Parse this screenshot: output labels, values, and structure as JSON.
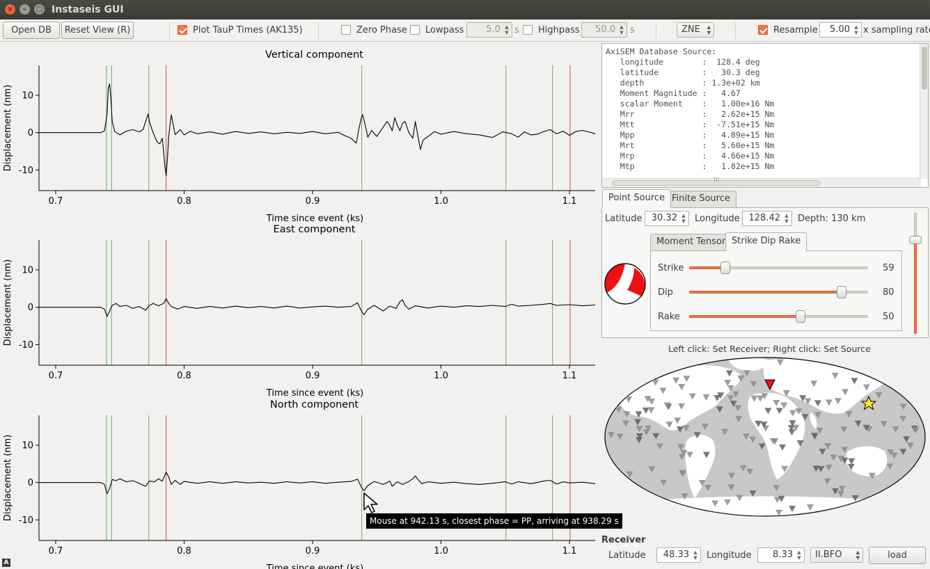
{
  "window": {
    "title": "Instaseis GUI",
    "close_glyph": "×",
    "minimize_glyph": "–",
    "maximize_glyph": "□"
  },
  "toolbar": {
    "open_db_label": "Open DB",
    "reset_view_label": "Reset View (R)",
    "plot_taup_label": "Plot TauP Times (AK135)",
    "plot_taup_checked": true,
    "zero_phase_label": "Zero Phase",
    "zero_phase_checked": false,
    "lowpass_label": "Lowpass",
    "lowpass_checked": false,
    "lowpass_value": "5.0",
    "lowpass_unit": "s",
    "highpass_label": "Highpass",
    "highpass_checked": false,
    "highpass_value": "50.0",
    "highpass_unit": "s",
    "components_value": "ZNE",
    "resample_label": "Resample",
    "resample_checked": true,
    "resample_value": "5.00",
    "resample_unit": "x sampling rate"
  },
  "plots": {
    "ylabel": "Displacement (nm)",
    "xlabel": "Time since event (ks)",
    "panels": [
      {
        "title": "Vertical component"
      },
      {
        "title": "East component"
      },
      {
        "title": "North component"
      }
    ]
  },
  "chart_data": {
    "type": "line",
    "xlim": [
      0.687,
      1.12
    ],
    "ylim": [
      -15.5,
      18
    ],
    "x_ticks": [
      "0.7",
      "0.8",
      "0.9",
      "1.0",
      "1.1"
    ],
    "x_tick_values": [
      0.7,
      0.8,
      0.9,
      1.0,
      1.1
    ],
    "y_ticks": [
      "10",
      "0",
      "-10"
    ],
    "y_tick_values": [
      10,
      0,
      -10
    ],
    "phase_lines": {
      "green": [
        0.7395,
        0.7435,
        0.7725,
        0.9383,
        1.0505,
        1.0868
      ],
      "red": [
        0.786,
        1.1005
      ]
    },
    "colors": {
      "trace": "#000000",
      "green": "#6aa86a",
      "red": "#cc4b4b"
    },
    "series": [
      {
        "points": [
          [
            0.687,
            0
          ],
          [
            0.735,
            0
          ],
          [
            0.738,
            0.5
          ],
          [
            0.74,
            5
          ],
          [
            0.741,
            12
          ],
          [
            0.742,
            13
          ],
          [
            0.743,
            9
          ],
          [
            0.744,
            3
          ],
          [
            0.746,
            0.3
          ],
          [
            0.75,
            -0.6
          ],
          [
            0.755,
            0.4
          ],
          [
            0.76,
            0.8
          ],
          [
            0.765,
            0.2
          ],
          [
            0.768,
            0.8
          ],
          [
            0.771,
            4
          ],
          [
            0.772,
            5
          ],
          [
            0.773,
            3
          ],
          [
            0.775,
            0.8
          ],
          [
            0.777,
            -1
          ],
          [
            0.779,
            -2.5
          ],
          [
            0.781,
            -3
          ],
          [
            0.783,
            -1.5
          ],
          [
            0.784,
            -5
          ],
          [
            0.785,
            -9
          ],
          [
            0.786,
            -11.5
          ],
          [
            0.787,
            -7
          ],
          [
            0.788,
            -1
          ],
          [
            0.789,
            2
          ],
          [
            0.79,
            4.8
          ],
          [
            0.791,
            3
          ],
          [
            0.793,
            -0.5
          ],
          [
            0.797,
            0.8
          ],
          [
            0.8,
            -0.6
          ],
          [
            0.805,
            0.4
          ],
          [
            0.81,
            -0.3
          ],
          [
            0.82,
            0.2
          ],
          [
            0.83,
            -0.4
          ],
          [
            0.84,
            0.3
          ],
          [
            0.85,
            -0.2
          ],
          [
            0.86,
            0.2
          ],
          [
            0.87,
            -0.3
          ],
          [
            0.88,
            0.1
          ],
          [
            0.89,
            -0.2
          ],
          [
            0.9,
            0.3
          ],
          [
            0.91,
            -0.3
          ],
          [
            0.92,
            0.1
          ],
          [
            0.925,
            -0.8
          ],
          [
            0.93,
            -1.5
          ],
          [
            0.934,
            -2.8
          ],
          [
            0.936,
            1
          ],
          [
            0.938,
            4
          ],
          [
            0.939,
            4.8
          ],
          [
            0.941,
            2
          ],
          [
            0.943,
            -1.2
          ],
          [
            0.946,
            0.6
          ],
          [
            0.95,
            -1
          ],
          [
            0.955,
            1.5
          ],
          [
            0.958,
            3
          ],
          [
            0.96,
            2
          ],
          [
            0.962,
            0.5
          ],
          [
            0.964,
            4
          ],
          [
            0.966,
            2
          ],
          [
            0.968,
            0.5
          ],
          [
            0.97,
            2.5
          ],
          [
            0.972,
            3
          ],
          [
            0.975,
            0
          ],
          [
            0.978,
            -1.5
          ],
          [
            0.98,
            3
          ],
          [
            0.982,
            -1
          ],
          [
            0.984,
            -4.5
          ],
          [
            0.986,
            -2
          ],
          [
            0.99,
            -1
          ],
          [
            0.995,
            0.3
          ],
          [
            1.0,
            -0.4
          ],
          [
            1.01,
            0.3
          ],
          [
            1.02,
            -0.3
          ],
          [
            1.03,
            -0.6
          ],
          [
            1.04,
            -1.3
          ],
          [
            1.048,
            0.2
          ],
          [
            1.055,
            -0.3
          ],
          [
            1.06,
            -1.2
          ],
          [
            1.065,
            0.2
          ],
          [
            1.07,
            -0.6
          ],
          [
            1.075,
            -0.4
          ],
          [
            1.08,
            0.3
          ],
          [
            1.085,
            0.8
          ],
          [
            1.09,
            -0.3
          ],
          [
            1.095,
            0.4
          ],
          [
            1.1,
            -0.7
          ],
          [
            1.105,
            0.3
          ],
          [
            1.11,
            0.6
          ],
          [
            1.115,
            0.2
          ],
          [
            1.12,
            -0.3
          ]
        ]
      },
      {
        "points": [
          [
            0.687,
            0
          ],
          [
            0.735,
            0
          ],
          [
            0.738,
            -0.5
          ],
          [
            0.74,
            -2.5
          ],
          [
            0.742,
            -1
          ],
          [
            0.744,
            0.5
          ],
          [
            0.747,
            1
          ],
          [
            0.75,
            0.2
          ],
          [
            0.755,
            0.5
          ],
          [
            0.76,
            -0.3
          ],
          [
            0.765,
            0.2
          ],
          [
            0.77,
            -0.8
          ],
          [
            0.773,
            0.5
          ],
          [
            0.776,
            1
          ],
          [
            0.78,
            0.4
          ],
          [
            0.784,
            1
          ],
          [
            0.786,
            2.3
          ],
          [
            0.788,
            1
          ],
          [
            0.79,
            0.2
          ],
          [
            0.795,
            -0.5
          ],
          [
            0.8,
            0.2
          ],
          [
            0.81,
            -0.3
          ],
          [
            0.82,
            0.2
          ],
          [
            0.83,
            -0.2
          ],
          [
            0.84,
            0.3
          ],
          [
            0.85,
            -0.1
          ],
          [
            0.86,
            0.2
          ],
          [
            0.87,
            -0.2
          ],
          [
            0.88,
            0.3
          ],
          [
            0.89,
            -0.2
          ],
          [
            0.9,
            0.1
          ],
          [
            0.91,
            0.3
          ],
          [
            0.92,
            0
          ],
          [
            0.93,
            0.2
          ],
          [
            0.935,
            1.2
          ],
          [
            0.938,
            -1
          ],
          [
            0.94,
            -2
          ],
          [
            0.943,
            -0.5
          ],
          [
            0.948,
            0.5
          ],
          [
            0.955,
            -1
          ],
          [
            0.96,
            0.3
          ],
          [
            0.965,
            -0.3
          ],
          [
            0.968,
            1.5
          ],
          [
            0.97,
            2
          ],
          [
            0.972,
            0.5
          ],
          [
            0.975,
            -0.5
          ],
          [
            0.98,
            0.4
          ],
          [
            0.99,
            -0.2
          ],
          [
            1.0,
            0.3
          ],
          [
            1.01,
            0
          ],
          [
            1.02,
            0.4
          ],
          [
            1.03,
            0.2
          ],
          [
            1.04,
            0.5
          ],
          [
            1.05,
            0.2
          ],
          [
            1.055,
            0.8
          ],
          [
            1.06,
            0.3
          ],
          [
            1.07,
            0.5
          ],
          [
            1.08,
            0.8
          ],
          [
            1.085,
            1
          ],
          [
            1.09,
            0.5
          ],
          [
            1.1,
            0.7
          ],
          [
            1.11,
            0.4
          ],
          [
            1.12,
            0.6
          ]
        ]
      },
      {
        "points": [
          [
            0.687,
            0
          ],
          [
            0.735,
            0
          ],
          [
            0.738,
            -0.5
          ],
          [
            0.74,
            -3
          ],
          [
            0.742,
            -1.5
          ],
          [
            0.744,
            0.8
          ],
          [
            0.747,
            0.5
          ],
          [
            0.75,
            1
          ],
          [
            0.755,
            0.2
          ],
          [
            0.76,
            0.5
          ],
          [
            0.765,
            -0.2
          ],
          [
            0.77,
            -1
          ],
          [
            0.773,
            0.4
          ],
          [
            0.777,
            0.2
          ],
          [
            0.78,
            1
          ],
          [
            0.783,
            0.4
          ],
          [
            0.786,
            2.8
          ],
          [
            0.788,
            1.5
          ],
          [
            0.79,
            -0.5
          ],
          [
            0.793,
            0.6
          ],
          [
            0.797,
            -0.5
          ],
          [
            0.8,
            0.3
          ],
          [
            0.81,
            -0.2
          ],
          [
            0.82,
            0.2
          ],
          [
            0.83,
            -0.2
          ],
          [
            0.84,
            0.2
          ],
          [
            0.85,
            -0.1
          ],
          [
            0.86,
            0.1
          ],
          [
            0.87,
            -0.2
          ],
          [
            0.88,
            0.2
          ],
          [
            0.89,
            -0.1
          ],
          [
            0.9,
            0.2
          ],
          [
            0.91,
            -0.2
          ],
          [
            0.92,
            0.1
          ],
          [
            0.93,
            0.3
          ],
          [
            0.935,
            0.9
          ],
          [
            0.938,
            -1.2
          ],
          [
            0.94,
            -2.2
          ],
          [
            0.943,
            -0.8
          ],
          [
            0.948,
            0.3
          ],
          [
            0.955,
            -0.5
          ],
          [
            0.96,
            0.4
          ],
          [
            0.962,
            -1
          ],
          [
            0.966,
            0.2
          ],
          [
            0.97,
            -0.5
          ],
          [
            0.975,
            0.3
          ],
          [
            0.978,
            1
          ],
          [
            0.98,
            1.8
          ],
          [
            0.982,
            0.8
          ],
          [
            0.985,
            -0.3
          ],
          [
            0.99,
            0.2
          ],
          [
            1.0,
            -0.2
          ],
          [
            1.01,
            0.1
          ],
          [
            1.02,
            -0.3
          ],
          [
            1.03,
            -0.5
          ],
          [
            1.04,
            -0.2
          ],
          [
            1.05,
            0.2
          ],
          [
            1.055,
            -0.4
          ],
          [
            1.06,
            0.2
          ],
          [
            1.07,
            -0.3
          ],
          [
            1.08,
            0.4
          ],
          [
            1.085,
            0.6
          ],
          [
            1.09,
            -0.4
          ],
          [
            1.095,
            0.2
          ],
          [
            1.1,
            -0.1
          ],
          [
            1.11,
            0.1
          ],
          [
            1.12,
            -0.3
          ]
        ]
      }
    ]
  },
  "source_text": {
    "lines": [
      "AxiSEM Database Source:",
      "   longitude        :  128.4 deg",
      "   latitude         :   30.3 deg",
      "   depth            : 1.3e+02 km",
      "   Moment Magnitude :   4.67",
      "   scalar Moment    :   1.00e+16 Nm",
      "   Mrr              :   2.62e+15 Nm",
      "   Mtt              :  -7.51e+15 Nm",
      "   Mpp              :   4.89e+15 Nm",
      "   Mrt              :   5.60e+15 Nm",
      "   Mrp              :   4.66e+15 Nm",
      "   Mtp              :   1.82e+15 Nm"
    ],
    "scroll_grip": "⁞⁞⁞"
  },
  "source_tabs": {
    "point_source_label": "Point Source",
    "finite_source_label": "Finite Source",
    "latitude_label": "Latitude",
    "latitude_value": "30.32",
    "longitude_label": "Longitude",
    "longitude_value": "128.42",
    "depth_text": "Depth: 130 km",
    "depth_slider_fraction": 0.2,
    "moment_tensor_label": "Moment Tensor",
    "strike_dip_rake_label": "Strike Dip Rake",
    "strike_label": "Strike",
    "strike_value": "59",
    "strike_fraction": 0.18,
    "dip_label": "Dip",
    "dip_value": "80",
    "dip_fraction": 0.87,
    "rake_label": "Rake",
    "rake_value": "50",
    "rake_fraction": 0.63
  },
  "map": {
    "hint": "Left click: Set Receiver; Right click: Set Source",
    "receiver_marker_color": "#ee1111",
    "source_marker_color": "#ffee22"
  },
  "receiver": {
    "heading": "Receiver",
    "latitude_label": "Latitude",
    "latitude_value": "48.33",
    "longitude_label": "Longitude",
    "longitude_value": "8.33",
    "station_value": "II.BFO",
    "load_label": "load"
  },
  "tooltip": {
    "text": "Mouse at 942.13 s, closest phase = PP, arriving at 938.29 s"
  },
  "status": {
    "indicator": "A"
  },
  "colors": {
    "accent": "#f07746"
  }
}
